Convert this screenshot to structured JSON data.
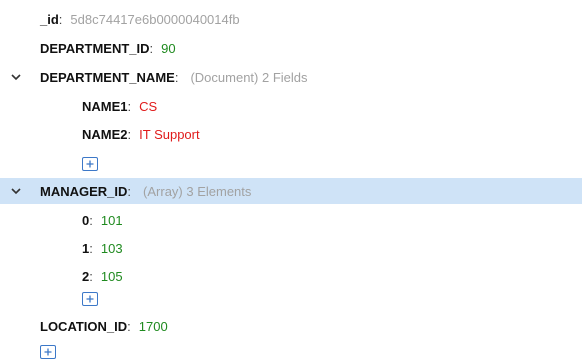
{
  "fields": {
    "id": {
      "key": "_id",
      "value": "5d8c74417e6b0000040014fb"
    },
    "department_id": {
      "key": "DEPARTMENT_ID",
      "value": "90"
    },
    "department_name": {
      "key": "DEPARTMENT_NAME",
      "meta": "(Document) 2 Fields",
      "children": [
        {
          "key": "NAME1",
          "value": "CS"
        },
        {
          "key": "NAME2",
          "value": "IT Support"
        }
      ]
    },
    "manager_id": {
      "key": "MANAGER_ID",
      "meta": "(Array) 3 Elements",
      "children": [
        {
          "key": "0",
          "value": "101"
        },
        {
          "key": "1",
          "value": "103"
        },
        {
          "key": "2",
          "value": "105"
        }
      ]
    },
    "location_id": {
      "key": "LOCATION_ID",
      "value": "1700"
    }
  },
  "separator": ":",
  "colors": {
    "string": "#e01b1b",
    "number": "#1f8a1f",
    "meta": "#a2a2a2",
    "selected_row": "#cfe3f7",
    "add_button_border": "#3c78c8"
  },
  "icons": {
    "expand": "chevron-down-icon",
    "add": "plus-icon"
  }
}
